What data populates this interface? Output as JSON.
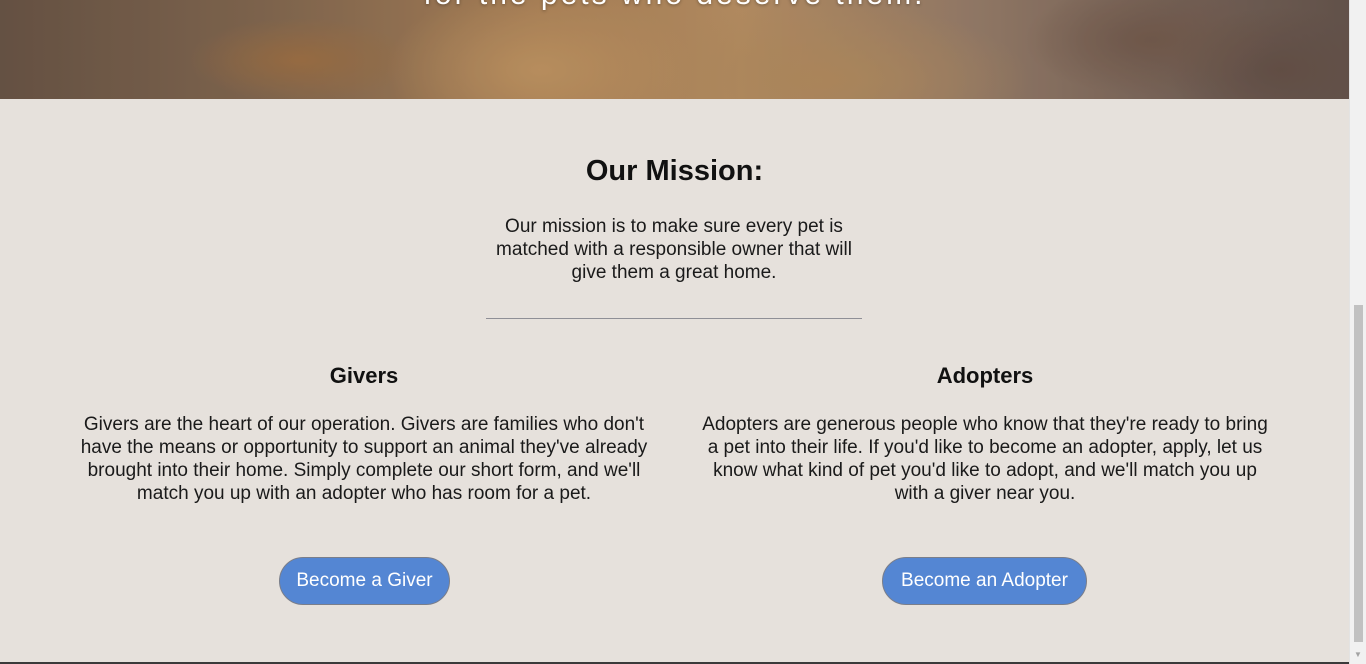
{
  "hero": {
    "tagline": "for the pets who deserve them."
  },
  "mission": {
    "title": "Our Mission:",
    "text": "Our mission is to make sure every pet is matched with a responsible owner that will give them a great home."
  },
  "givers": {
    "heading": "Givers",
    "text": "Givers are the heart of our operation. Givers are families who don't have the means or opportunity to support an animal they've already brought into their home. Simply complete our short form, and we'll match you up with an adopter who has room for a pet.",
    "button_label": "Become a Giver"
  },
  "adopters": {
    "heading": "Adopters",
    "text": "Adopters are generous people who know that they're ready to bring a pet into their life. If you'd like to become an adopter, apply, let us know what kind of pet you'd like to adopt, and we'll match you up with a giver near you.",
    "button_label": "Become an Adopter"
  },
  "scrollbar": {
    "down_icon": "▼"
  },
  "colors": {
    "background": "#e6e1dc",
    "button": "#5486d3",
    "divider": "#8f8f96"
  }
}
